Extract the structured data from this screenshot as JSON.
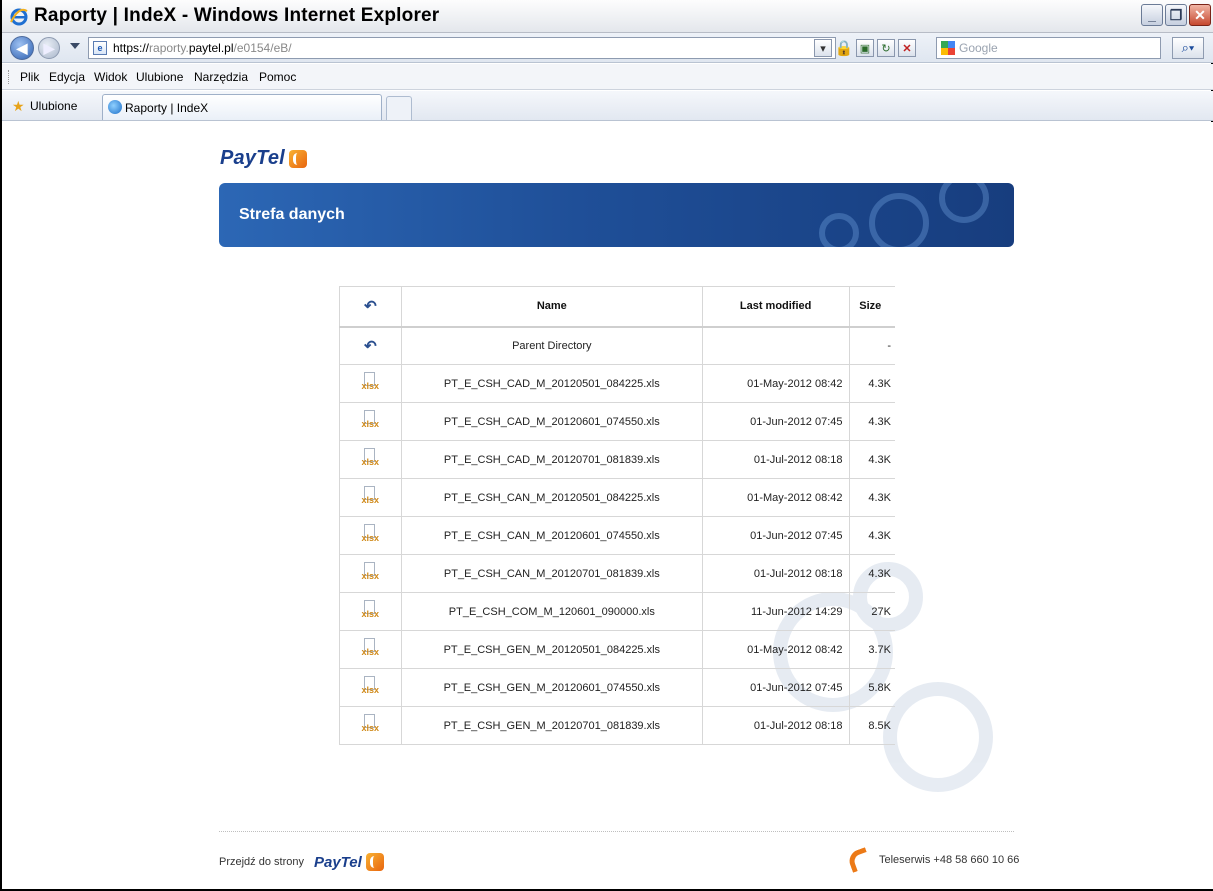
{
  "window": {
    "title": "Raporty | IndeX - Windows Internet Explorer"
  },
  "address_bar": {
    "url_prefix": "https://",
    "url_dim1": "raporty.",
    "url_host": "paytel.pl",
    "url_path": "/e0154/eB/",
    "search_placeholder": "Google"
  },
  "menu": {
    "items": [
      "Plik",
      "Edycja",
      "Widok",
      "Ulubione",
      "Narzędzia",
      "Pomoc"
    ]
  },
  "favorites": {
    "label": "Ulubione",
    "tab_label": "Raporty | IndeX"
  },
  "page": {
    "logo_text": "PayTel",
    "banner_title": "Strefa danych",
    "table": {
      "headers": {
        "name": "Name",
        "modified": "Last modified",
        "size": "Size"
      },
      "parent": {
        "name": "Parent Directory",
        "size": "-"
      },
      "rows": [
        {
          "name": "PT_E_CSH_CAD_M_20120501_084225.xls",
          "modified": "01-May-2012 08:42",
          "size": "4.3K"
        },
        {
          "name": "PT_E_CSH_CAD_M_20120601_074550.xls",
          "modified": "01-Jun-2012 07:45",
          "size": "4.3K"
        },
        {
          "name": "PT_E_CSH_CAD_M_20120701_081839.xls",
          "modified": "01-Jul-2012 08:18",
          "size": "4.3K"
        },
        {
          "name": "PT_E_CSH_CAN_M_20120501_084225.xls",
          "modified": "01-May-2012 08:42",
          "size": "4.3K"
        },
        {
          "name": "PT_E_CSH_CAN_M_20120601_074550.xls",
          "modified": "01-Jun-2012 07:45",
          "size": "4.3K"
        },
        {
          "name": "PT_E_CSH_CAN_M_20120701_081839.xls",
          "modified": "01-Jul-2012 08:18",
          "size": "4.3K"
        },
        {
          "name": "PT_E_CSH_COM_M_120601_090000.xls",
          "modified": "11-Jun-2012 14:29",
          "size": "27K"
        },
        {
          "name": "PT_E_CSH_GEN_M_20120501_084225.xls",
          "modified": "01-May-2012 08:42",
          "size": "3.7K"
        },
        {
          "name": "PT_E_CSH_GEN_M_20120601_074550.xls",
          "modified": "01-Jun-2012 07:45",
          "size": "5.8K"
        },
        {
          "name": "PT_E_CSH_GEN_M_20120701_081839.xls",
          "modified": "01-Jul-2012 08:18",
          "size": "8.5K"
        }
      ],
      "file_icon_label": "xlsx"
    },
    "footer": {
      "goto_label": "Przejdź do strony",
      "logo_text": "PayTel",
      "teleservice": "Teleserwis +48 58 660 10 66"
    }
  }
}
